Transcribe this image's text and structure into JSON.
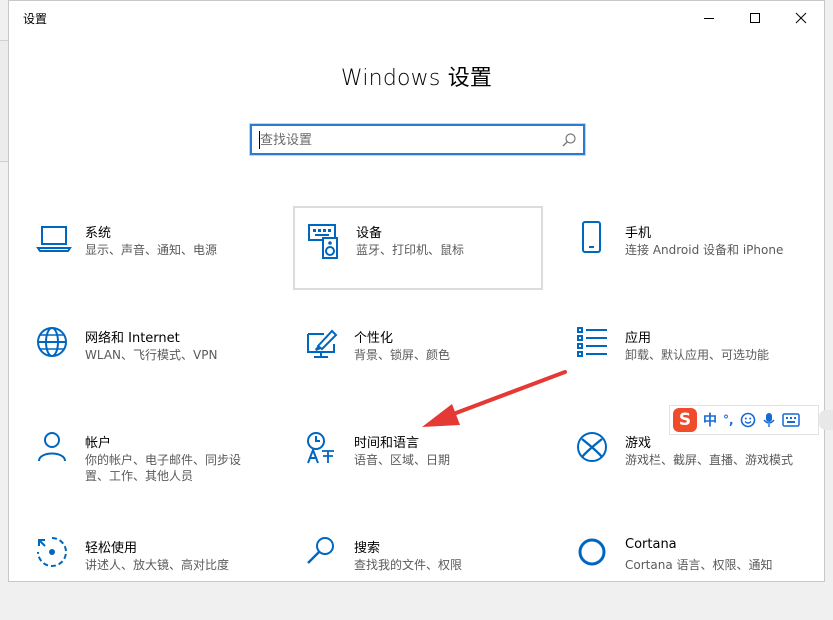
{
  "window": {
    "title": "设置"
  },
  "page": {
    "heading": "Windows 设置"
  },
  "search": {
    "placeholder": "查找设置"
  },
  "tiles": [
    {
      "title": "系统",
      "desc": "显示、声音、通知、电源",
      "icon": "laptop-icon"
    },
    {
      "title": "设备",
      "desc": "蓝牙、打印机、鼠标",
      "icon": "keyboard-speaker-icon"
    },
    {
      "title": "手机",
      "desc": "连接 Android 设备和 iPhone",
      "icon": "phone-icon"
    },
    {
      "title": "网络和 Internet",
      "desc": "WLAN、飞行模式、VPN",
      "icon": "globe-icon"
    },
    {
      "title": "个性化",
      "desc": "背景、锁屏、颜色",
      "icon": "paint-screen-icon"
    },
    {
      "title": "应用",
      "desc": "卸载、默认应用、可选功能",
      "icon": "apps-list-icon"
    },
    {
      "title": "帐户",
      "desc": "你的帐户、电子邮件、同步设置、工作、其他人员",
      "icon": "person-icon"
    },
    {
      "title": "时间和语言",
      "desc": "语音、区域、日期",
      "icon": "time-language-icon"
    },
    {
      "title": "游戏",
      "desc": "游戏栏、截屏、直播、游戏模式",
      "icon": "xbox-icon"
    },
    {
      "title": "轻松使用",
      "desc": "讲述人、放大镜、高对比度",
      "icon": "ease-of-access-icon"
    },
    {
      "title": "搜索",
      "desc": "查找我的文件、权限",
      "icon": "magnifier-icon"
    },
    {
      "title": "Cortana",
      "desc": "Cortana 语言、权限、通知",
      "icon": "cortana-ring-icon"
    }
  ],
  "ime": {
    "logo": "S",
    "mode": "中",
    "punct": "°,"
  },
  "colors": {
    "accent": "#0067c0",
    "arrow": "#e53935"
  }
}
